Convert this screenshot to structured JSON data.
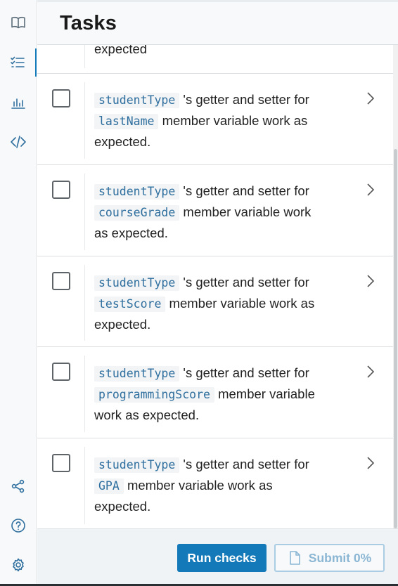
{
  "header": {
    "title": "Tasks"
  },
  "sidebar": {
    "top_icons": [
      "book-icon",
      "checklist-icon",
      "chart-icon",
      "code-icon"
    ],
    "bottom_icons": [
      "share-icon",
      "help-icon",
      "settings-icon"
    ],
    "active": "checklist-icon"
  },
  "tasks": {
    "partial_text": "expected",
    "items": [
      {
        "code1": "studentType",
        "text1": "'s getter and setter for",
        "code2": "lastName",
        "text2": "member variable work as",
        "text3": "expected."
      },
      {
        "code1": "studentType",
        "text1": "'s getter and setter for",
        "code2": "courseGrade",
        "text2": "member variable work",
        "text3": "as expected."
      },
      {
        "code1": "studentType",
        "text1": "'s getter and setter for",
        "code2": "testScore",
        "text2": "member variable work as",
        "text3": "expected."
      },
      {
        "code1": "studentType",
        "text1": "'s getter and setter for",
        "code2": "programmingScore",
        "text2": "member variable",
        "text3": "work as expected."
      },
      {
        "code1": "studentType",
        "text1": "'s getter and setter for",
        "code2": "GPA",
        "text2": "member variable work as",
        "text3": "expected."
      }
    ]
  },
  "footer": {
    "run_label": "Run checks",
    "submit_label": "Submit 0%"
  },
  "colors": {
    "accent": "#1479b8",
    "code_text": "#2f6f9f"
  }
}
